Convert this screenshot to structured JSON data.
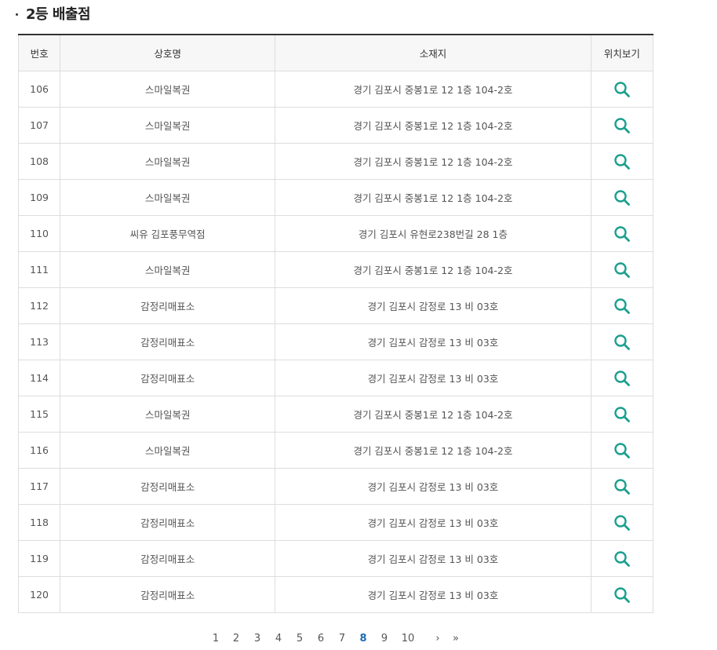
{
  "section": {
    "title": "2등 배출점"
  },
  "table": {
    "headers": {
      "no": "번호",
      "name": "상호명",
      "address": "소재지",
      "map": "위치보기"
    },
    "rows": [
      {
        "no": "106",
        "name": "스마일복권",
        "address": "경기 김포시 중봉1로 12 1층 104-2호"
      },
      {
        "no": "107",
        "name": "스마일복권",
        "address": "경기 김포시 중봉1로 12 1층 104-2호"
      },
      {
        "no": "108",
        "name": "스마일복권",
        "address": "경기 김포시 중봉1로 12 1층 104-2호"
      },
      {
        "no": "109",
        "name": "스마일복권",
        "address": "경기 김포시 중봉1로 12 1층 104-2호"
      },
      {
        "no": "110",
        "name": "씨유 김포풍무역점",
        "address": "경기 김포시 유현로238번길 28 1층"
      },
      {
        "no": "111",
        "name": "스마일복권",
        "address": "경기 김포시 중봉1로 12 1층 104-2호"
      },
      {
        "no": "112",
        "name": "감정리매표소",
        "address": "경기 김포시 감정로 13 비 03호"
      },
      {
        "no": "113",
        "name": "감정리매표소",
        "address": "경기 김포시 감정로 13 비 03호"
      },
      {
        "no": "114",
        "name": "감정리매표소",
        "address": "경기 김포시 감정로 13 비 03호"
      },
      {
        "no": "115",
        "name": "스마일복권",
        "address": "경기 김포시 중봉1로 12 1층 104-2호"
      },
      {
        "no": "116",
        "name": "스마일복권",
        "address": "경기 김포시 중봉1로 12 1층 104-2호"
      },
      {
        "no": "117",
        "name": "감정리매표소",
        "address": "경기 김포시 감정로 13 비 03호"
      },
      {
        "no": "118",
        "name": "감정리매표소",
        "address": "경기 김포시 감정로 13 비 03호"
      },
      {
        "no": "119",
        "name": "감정리매표소",
        "address": "경기 김포시 감정로 13 비 03호"
      },
      {
        "no": "120",
        "name": "감정리매표소",
        "address": "경기 김포시 감정로 13 비 03호"
      }
    ],
    "map_icon": "search-icon",
    "icon_color": "#1a9f8e"
  },
  "pagination": {
    "pages": [
      "1",
      "2",
      "3",
      "4",
      "5",
      "6",
      "7",
      "8",
      "9",
      "10"
    ],
    "current": "8",
    "next_label": "›",
    "last_label": "»",
    "active_color": "#1b6bb5"
  }
}
